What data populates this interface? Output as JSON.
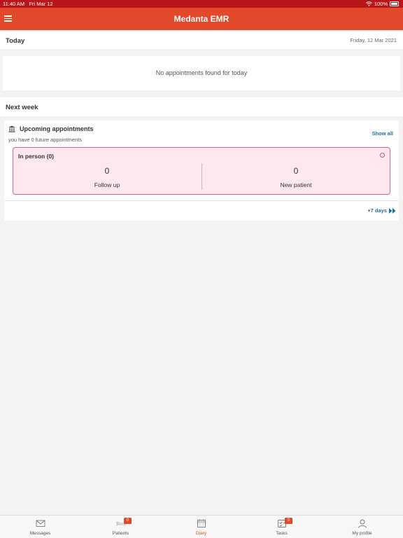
{
  "status_bar": {
    "time": "11:40 AM",
    "date": "Fri Mar 12",
    "battery": "100%"
  },
  "app_bar": {
    "title": "Medanta EMR"
  },
  "today": {
    "label": "Today",
    "date": "Friday, 12 Mar 2021",
    "empty_message": "No appointments found for today"
  },
  "next_week": {
    "label": "Next week",
    "upcoming_title": "Upcoming appointments",
    "show_all": "Show all",
    "future_text": "you have 0 future appointments",
    "in_person": {
      "title": "In person (0)",
      "follow_up": {
        "value": "0",
        "label": "Follow up"
      },
      "new_patient": {
        "value": "0",
        "label": "New patient"
      }
    },
    "plus_days": "+7 days"
  },
  "tab_bar": {
    "items": [
      {
        "label": "Messages",
        "icon": "envelope-icon",
        "badge": ""
      },
      {
        "label": "Patients",
        "icon": "patient-bed-icon",
        "badge": "0"
      },
      {
        "label": "Diary",
        "icon": "calendar-icon",
        "badge": ""
      },
      {
        "label": "Tasks",
        "icon": "tasks-icon",
        "badge": "0"
      },
      {
        "label": "My profile",
        "icon": "profile-icon",
        "badge": ""
      }
    ]
  },
  "colors": {
    "header": "#e2492b",
    "status_bar": "#b8161b",
    "link": "#1d6fa5",
    "in_person_border": "#e06092",
    "in_person_bg": "#fde8ef"
  }
}
